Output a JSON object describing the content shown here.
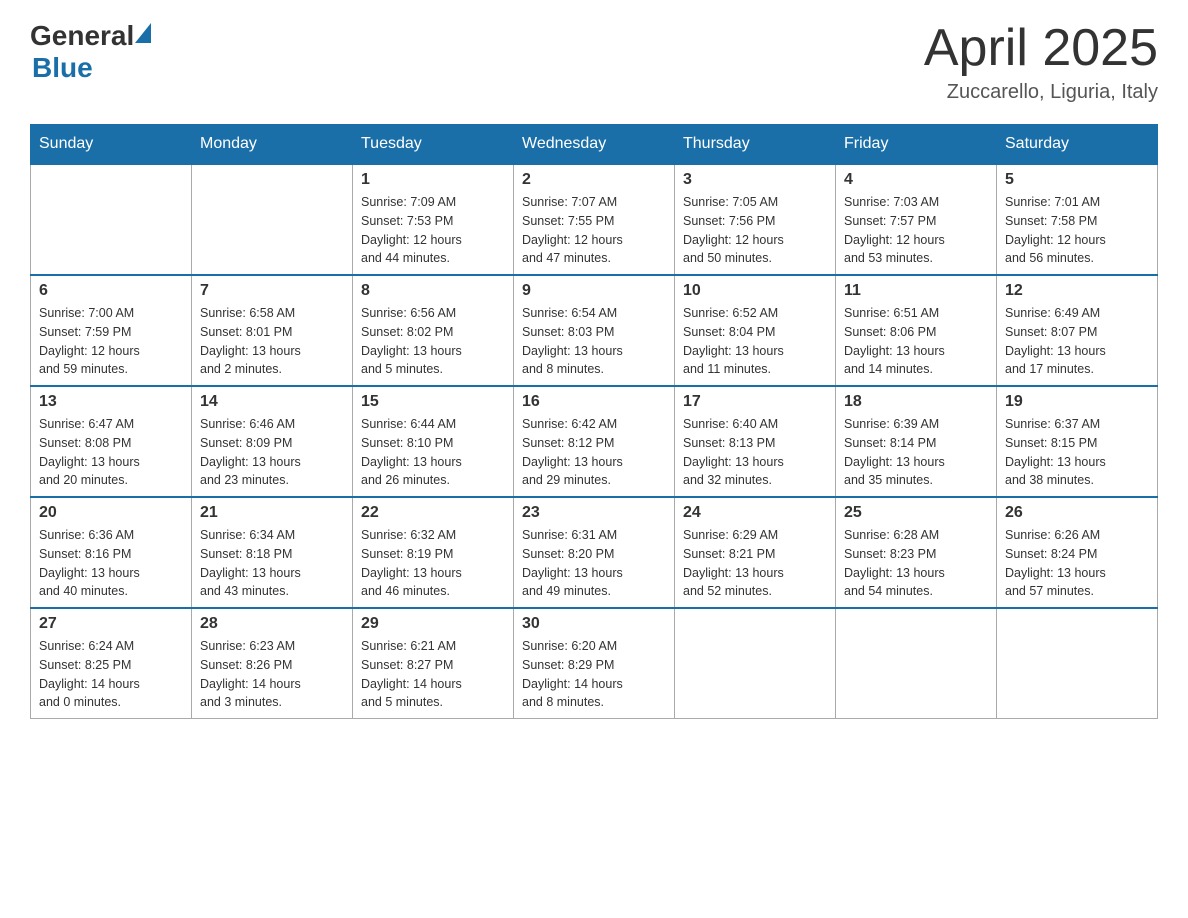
{
  "header": {
    "logo": {
      "general": "General",
      "blue": "Blue"
    },
    "title": "April 2025",
    "location": "Zuccarello, Liguria, Italy"
  },
  "calendar": {
    "days_of_week": [
      "Sunday",
      "Monday",
      "Tuesday",
      "Wednesday",
      "Thursday",
      "Friday",
      "Saturday"
    ],
    "weeks": [
      {
        "days": [
          {
            "number": "",
            "info": ""
          },
          {
            "number": "",
            "info": ""
          },
          {
            "number": "1",
            "info": "Sunrise: 7:09 AM\nSunset: 7:53 PM\nDaylight: 12 hours\nand 44 minutes."
          },
          {
            "number": "2",
            "info": "Sunrise: 7:07 AM\nSunset: 7:55 PM\nDaylight: 12 hours\nand 47 minutes."
          },
          {
            "number": "3",
            "info": "Sunrise: 7:05 AM\nSunset: 7:56 PM\nDaylight: 12 hours\nand 50 minutes."
          },
          {
            "number": "4",
            "info": "Sunrise: 7:03 AM\nSunset: 7:57 PM\nDaylight: 12 hours\nand 53 minutes."
          },
          {
            "number": "5",
            "info": "Sunrise: 7:01 AM\nSunset: 7:58 PM\nDaylight: 12 hours\nand 56 minutes."
          }
        ]
      },
      {
        "days": [
          {
            "number": "6",
            "info": "Sunrise: 7:00 AM\nSunset: 7:59 PM\nDaylight: 12 hours\nand 59 minutes."
          },
          {
            "number": "7",
            "info": "Sunrise: 6:58 AM\nSunset: 8:01 PM\nDaylight: 13 hours\nand 2 minutes."
          },
          {
            "number": "8",
            "info": "Sunrise: 6:56 AM\nSunset: 8:02 PM\nDaylight: 13 hours\nand 5 minutes."
          },
          {
            "number": "9",
            "info": "Sunrise: 6:54 AM\nSunset: 8:03 PM\nDaylight: 13 hours\nand 8 minutes."
          },
          {
            "number": "10",
            "info": "Sunrise: 6:52 AM\nSunset: 8:04 PM\nDaylight: 13 hours\nand 11 minutes."
          },
          {
            "number": "11",
            "info": "Sunrise: 6:51 AM\nSunset: 8:06 PM\nDaylight: 13 hours\nand 14 minutes."
          },
          {
            "number": "12",
            "info": "Sunrise: 6:49 AM\nSunset: 8:07 PM\nDaylight: 13 hours\nand 17 minutes."
          }
        ]
      },
      {
        "days": [
          {
            "number": "13",
            "info": "Sunrise: 6:47 AM\nSunset: 8:08 PM\nDaylight: 13 hours\nand 20 minutes."
          },
          {
            "number": "14",
            "info": "Sunrise: 6:46 AM\nSunset: 8:09 PM\nDaylight: 13 hours\nand 23 minutes."
          },
          {
            "number": "15",
            "info": "Sunrise: 6:44 AM\nSunset: 8:10 PM\nDaylight: 13 hours\nand 26 minutes."
          },
          {
            "number": "16",
            "info": "Sunrise: 6:42 AM\nSunset: 8:12 PM\nDaylight: 13 hours\nand 29 minutes."
          },
          {
            "number": "17",
            "info": "Sunrise: 6:40 AM\nSunset: 8:13 PM\nDaylight: 13 hours\nand 32 minutes."
          },
          {
            "number": "18",
            "info": "Sunrise: 6:39 AM\nSunset: 8:14 PM\nDaylight: 13 hours\nand 35 minutes."
          },
          {
            "number": "19",
            "info": "Sunrise: 6:37 AM\nSunset: 8:15 PM\nDaylight: 13 hours\nand 38 minutes."
          }
        ]
      },
      {
        "days": [
          {
            "number": "20",
            "info": "Sunrise: 6:36 AM\nSunset: 8:16 PM\nDaylight: 13 hours\nand 40 minutes."
          },
          {
            "number": "21",
            "info": "Sunrise: 6:34 AM\nSunset: 8:18 PM\nDaylight: 13 hours\nand 43 minutes."
          },
          {
            "number": "22",
            "info": "Sunrise: 6:32 AM\nSunset: 8:19 PM\nDaylight: 13 hours\nand 46 minutes."
          },
          {
            "number": "23",
            "info": "Sunrise: 6:31 AM\nSunset: 8:20 PM\nDaylight: 13 hours\nand 49 minutes."
          },
          {
            "number": "24",
            "info": "Sunrise: 6:29 AM\nSunset: 8:21 PM\nDaylight: 13 hours\nand 52 minutes."
          },
          {
            "number": "25",
            "info": "Sunrise: 6:28 AM\nSunset: 8:23 PM\nDaylight: 13 hours\nand 54 minutes."
          },
          {
            "number": "26",
            "info": "Sunrise: 6:26 AM\nSunset: 8:24 PM\nDaylight: 13 hours\nand 57 minutes."
          }
        ]
      },
      {
        "days": [
          {
            "number": "27",
            "info": "Sunrise: 6:24 AM\nSunset: 8:25 PM\nDaylight: 14 hours\nand 0 minutes."
          },
          {
            "number": "28",
            "info": "Sunrise: 6:23 AM\nSunset: 8:26 PM\nDaylight: 14 hours\nand 3 minutes."
          },
          {
            "number": "29",
            "info": "Sunrise: 6:21 AM\nSunset: 8:27 PM\nDaylight: 14 hours\nand 5 minutes."
          },
          {
            "number": "30",
            "info": "Sunrise: 6:20 AM\nSunset: 8:29 PM\nDaylight: 14 hours\nand 8 minutes."
          },
          {
            "number": "",
            "info": ""
          },
          {
            "number": "",
            "info": ""
          },
          {
            "number": "",
            "info": ""
          }
        ]
      }
    ]
  }
}
